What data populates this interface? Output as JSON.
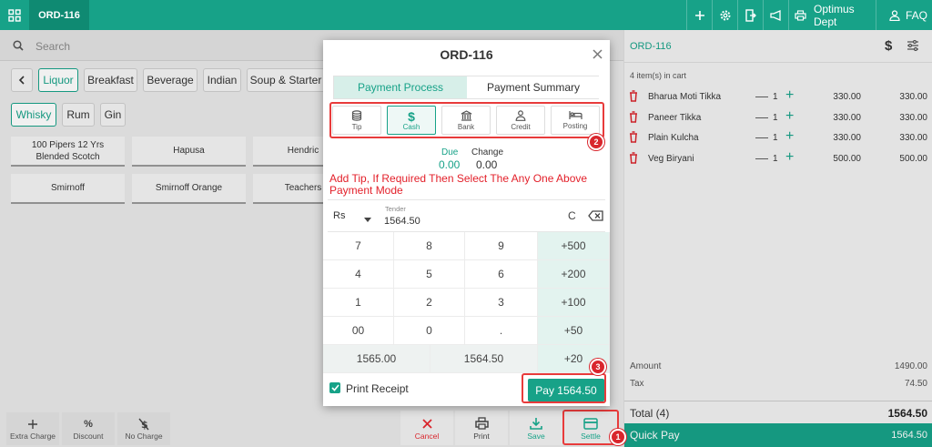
{
  "topbar": {
    "order_tab": "ORD-116",
    "dept_label": "Optimus Dept",
    "faq_label": "FAQ",
    "icons": [
      "grid-icon",
      "plus-icon",
      "gear-icon",
      "exit-icon",
      "megaphone-icon",
      "printer-icon",
      "user-icon"
    ]
  },
  "search": {
    "placeholder": "Search"
  },
  "categories": [
    "Liquor",
    "Breakfast",
    "Beverage",
    "Indian",
    "Soup & Starter"
  ],
  "subcategories": [
    "Whisky",
    "Rum",
    "Gin"
  ],
  "products": [
    [
      "100 Pipers 12 Yrs",
      "Blended Scotch"
    ],
    [
      "Hapusa"
    ],
    [
      "Hendric"
    ],
    [
      "Smirnoff"
    ],
    [
      "Smirnoff Orange"
    ],
    [
      "Teachers"
    ]
  ],
  "left_actions": [
    "Extra Charge",
    "Discount",
    "No Charge"
  ],
  "bottom_actions": [
    "Cancel",
    "Print",
    "Save",
    "Settle"
  ],
  "cart": {
    "order_id": "ORD-116",
    "count_text": "4 item(s) in cart",
    "items": [
      {
        "name": "Bharua Moti Tikka",
        "qty": "1",
        "price": "330.00",
        "amount": "330.00"
      },
      {
        "name": "Paneer Tikka",
        "qty": "1",
        "price": "330.00",
        "amount": "330.00"
      },
      {
        "name": "Plain Kulcha",
        "qty": "1",
        "price": "330.00",
        "amount": "330.00"
      },
      {
        "name": "Veg Biryani",
        "qty": "1",
        "price": "500.00",
        "amount": "500.00"
      }
    ],
    "amount_label": "Amount",
    "amount_value": "1490.00",
    "tax_label": "Tax",
    "tax_value": "74.50",
    "total_label": "Total  (4)",
    "total_value": "1564.50",
    "quickpay_label": "Quick Pay",
    "quickpay_value": "1564.50"
  },
  "modal": {
    "title": "ORD-116",
    "tab_process": "Payment Process",
    "tab_summary": "Payment Summary",
    "modes": [
      "Tip",
      "Cash",
      "Bank",
      "Credit",
      "Posting"
    ],
    "due_label": "Due",
    "due_value": "0.00",
    "change_label": "Change",
    "change_value": "0.00",
    "annotation": "Add Tip, If Required Then Select The Any One Above Payment Mode",
    "currency": "Rs",
    "tender_label": "Tender",
    "tender_value": "1564.50",
    "clear": "C",
    "keys": [
      [
        "7",
        "8",
        "9",
        "+500"
      ],
      [
        "4",
        "5",
        "6",
        "+200"
      ],
      [
        "1",
        "2",
        "3",
        "+100"
      ],
      [
        "00",
        "0",
        ".",
        "+50"
      ]
    ],
    "quick_amounts": [
      "1565.00",
      "1564.50",
      "+20"
    ],
    "print_receipt": "Print Receipt",
    "pay_button": "Pay 1564.50"
  },
  "badges": [
    "1",
    "2",
    "3"
  ],
  "colors": {
    "accent": "#17a288",
    "callout": "#e83b3b",
    "delete": "#d9262d"
  }
}
